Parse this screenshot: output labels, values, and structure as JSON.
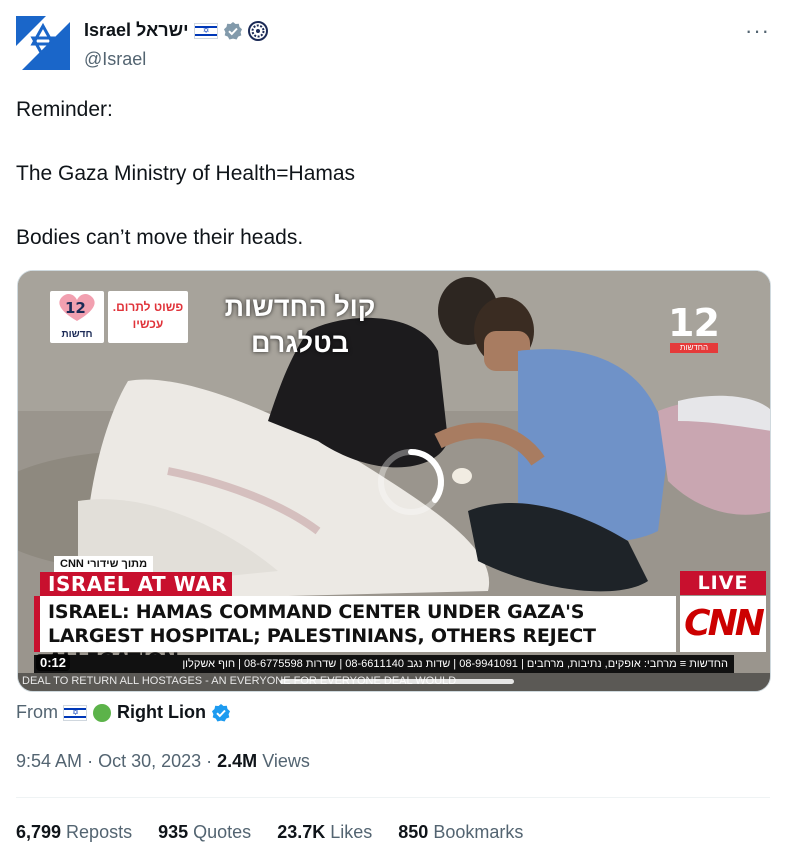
{
  "author": {
    "name": "Israel",
    "name_hebrew": "ישראל",
    "handle": "@Israel",
    "verified": "gray-checkmark",
    "affiliate_badge": "shield-badge",
    "flag": "israel-flag-icon"
  },
  "tweet": {
    "lines": [
      "Reminder:",
      "The Gaza Ministry of Health=Hamas",
      "Bodies can’t move their heads."
    ]
  },
  "media": {
    "hebrew_overlay": "קול החדשות בטלגרם",
    "logo_label": "חדשות",
    "promo_text": "פשוט לתרום. עכשיו",
    "channel_number": "12",
    "channel_tag": "החדשות",
    "cnn_tag": "מתוך שידורי CNN",
    "war_banner": "ISRAEL AT WAR",
    "headline": "ISRAEL: HAMAS COMMAND CENTER UNDER GAZA'S LARGEST HOSPITAL; PALESTINIANS, OTHERS REJECT ALLEGATION",
    "live_label": "LIVE",
    "cnn_logo": "CNN",
    "ticker": "החדשות ≡ מרחבי: אופקים, נתיבות, מרחבים | 08-9941091 | שדות נגב 08-6611140 | שדרות 08-6775598 | חוף אשקלון",
    "duration": "0:12",
    "lower_ticker": "DEAL TO RETURN ALL HOSTAGES - AN EVERYONE FOR EVERYONE DEAL WOULD"
  },
  "from": {
    "prefix": "From",
    "name": "Right Lion",
    "badge_colors": {
      "dot": "#4caf50",
      "verified": "#1d9bf0"
    }
  },
  "meta": {
    "time": "9:54 AM",
    "date": "Oct 30, 2023",
    "views_count": "2.4M",
    "views_label": "Views"
  },
  "stats": [
    {
      "count": "6,799",
      "label": "Reposts"
    },
    {
      "count": "935",
      "label": "Quotes"
    },
    {
      "count": "23.7K",
      "label": "Likes"
    },
    {
      "count": "850",
      "label": "Bookmarks"
    }
  ],
  "more_label": "···"
}
